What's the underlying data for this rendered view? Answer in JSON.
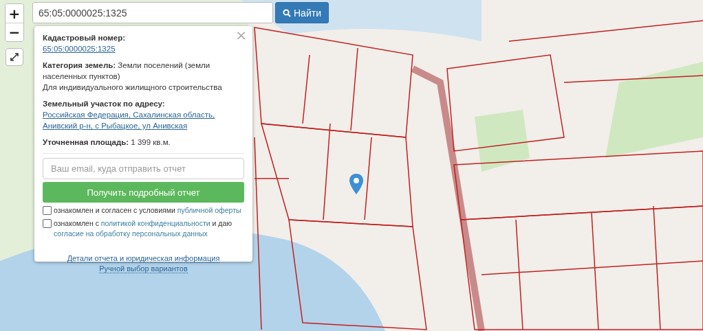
{
  "zoom_controls": [
    {
      "label": "+"
    },
    {
      "label": "−"
    }
  ],
  "search": {
    "value": "65:05:0000025:1325",
    "button": "Найти"
  },
  "popup": {
    "close": "×",
    "fields": [
      {
        "label": "Кадастровый номер:",
        "value": "65:05:0000025:1325",
        "kind": "link"
      },
      {
        "label": "Категория земель:",
        "value": "Земли поселений (земли населенных пунктов)",
        "kind": "text",
        "note": "Для индивидуального жилищного строительства"
      },
      {
        "label": "Земельный участок по адресу:",
        "value": "Российская Федерация, Сахалинская область, Анивский р-н, с Рыбацкое, ул Анивская",
        "kind": "link"
      },
      {
        "label": "Уточненная площадь:",
        "value": "1 399 кв.м.",
        "kind": "text"
      }
    ],
    "email_placeholder": "Ваш email, куда отправить отчет",
    "submit": "Получить подробный отчет",
    "consents": [
      {
        "checked": false,
        "parts": [
          {
            "text": "ознакомлен и согласен с условиями ",
            "link": false
          },
          {
            "text": "публичной оферты",
            "link": true
          }
        ]
      },
      {
        "checked": false,
        "parts": [
          {
            "text": "ознакомлен с ",
            "link": false
          },
          {
            "text": "политикой конфиденциальности",
            "link": true
          },
          {
            "text": " и даю ",
            "link": false
          },
          {
            "text": "согласие на обработку персональных данных",
            "link": true
          }
        ]
      }
    ],
    "links": [
      "Детали отчета и юридическая информация",
      "Ручной выбор вариантов"
    ]
  }
}
